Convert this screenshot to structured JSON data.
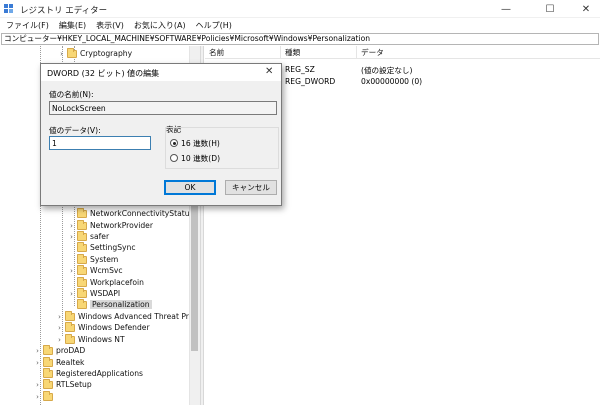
{
  "window": {
    "title": "レジストリ エディター",
    "controls": [
      "—",
      "☐",
      "✕"
    ]
  },
  "menu": [
    "ファイル(F)",
    "編集(E)",
    "表示(V)",
    "お気に入り(A)",
    "ヘルプ(H)"
  ],
  "address": "コンピューター¥HKEY_LOCAL_MACHINE¥SOFTWARE¥Policies¥Microsoft¥Windows¥Personalization",
  "tree": [
    {
      "label": "Cryptography",
      "expander": "›"
    },
    {
      "label": "NetworkConnectivityStatusInd",
      "expander": ""
    },
    {
      "label": "NetworkProvider",
      "expander": "›"
    },
    {
      "label": "safer",
      "expander": "›"
    },
    {
      "label": "SettingSync",
      "expander": ""
    },
    {
      "label": "System",
      "expander": ""
    },
    {
      "label": "WcmSvc",
      "expander": "›"
    },
    {
      "label": "Workplacefoin",
      "expander": ""
    },
    {
      "label": "WSDAPI",
      "expander": "›"
    },
    {
      "label": "Personalization",
      "expander": ""
    },
    {
      "label": "Windows Advanced Threat Protec",
      "expander": "›"
    },
    {
      "label": "Windows Defender",
      "expander": "›"
    },
    {
      "label": "Windows NT",
      "expander": "›"
    },
    {
      "label": "proDAD",
      "expander": "›"
    },
    {
      "label": "Realtek",
      "expander": "›"
    },
    {
      "label": "RegisteredApplications",
      "expander": ""
    },
    {
      "label": "RTLSetup",
      "expander": "›"
    },
    {
      "label": "",
      "expander": "›"
    }
  ],
  "list": {
    "headers": [
      "名前",
      "種類",
      "データ"
    ],
    "rows": [
      {
        "type": "REG_SZ",
        "data": "(値の設定なし)"
      },
      {
        "type": "REG_DWORD",
        "data": "0x00000000 (0)"
      }
    ]
  },
  "dialog": {
    "title": "DWORD (32 ビット) 値の編集",
    "close": "✕",
    "name_label": "値の名前(N):",
    "name_value": "NoLockScreen",
    "data_label": "値のデータ(V):",
    "data_value": "1",
    "base_label": "表記",
    "radio_hex": "16 進数(H)",
    "radio_dec": "10 進数(D)",
    "ok": "OK",
    "cancel": "キャンセル"
  }
}
